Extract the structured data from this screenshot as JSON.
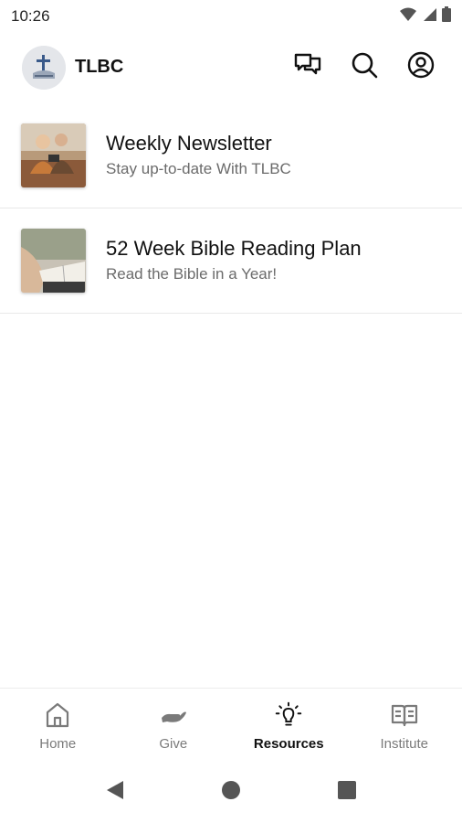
{
  "status_bar": {
    "time": "10:26",
    "icons": [
      "wifi-icon",
      "signal-icon",
      "battery-icon"
    ]
  },
  "header": {
    "title": "TLBC",
    "actions": [
      "chat-icon",
      "search-icon",
      "profile-icon"
    ]
  },
  "resources": [
    {
      "title": "Weekly Newsletter",
      "subtitle": "Stay up-to-date With TLBC"
    },
    {
      "title": "52 Week Bible Reading Plan",
      "subtitle": "Read the Bible in a Year!"
    }
  ],
  "bottom_nav": {
    "tabs": [
      {
        "label": "Home",
        "icon": "home-icon",
        "active": false
      },
      {
        "label": "Give",
        "icon": "give-hand-icon",
        "active": false
      },
      {
        "label": "Resources",
        "icon": "lightbulb-icon",
        "active": true
      },
      {
        "label": "Institute",
        "icon": "book-icon",
        "active": false
      }
    ]
  },
  "system_nav": {
    "buttons": [
      "back-icon",
      "home-circle-icon",
      "recents-icon"
    ]
  },
  "colors": {
    "active_tab": "#111111",
    "inactive_tab": "#7a7a7a",
    "divider": "#e8e8e8"
  }
}
